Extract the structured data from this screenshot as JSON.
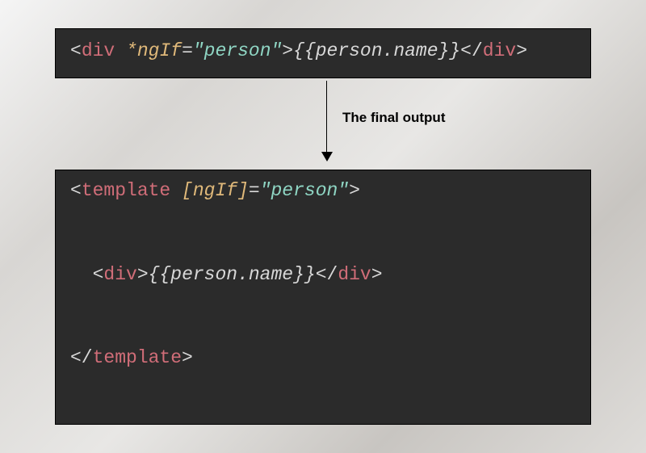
{
  "label": "The final output",
  "top": {
    "tokens": [
      {
        "t": "<",
        "cls": "tok-bracket"
      },
      {
        "t": "div",
        "cls": "tok-tag"
      },
      {
        "t": " ",
        "cls": "tok-plain"
      },
      {
        "t": "*ngIf",
        "cls": "tok-attr"
      },
      {
        "t": "=",
        "cls": "tok-bracket"
      },
      {
        "t": "\"person\"",
        "cls": "tok-string"
      },
      {
        "t": ">",
        "cls": "tok-bracket"
      },
      {
        "t": "{{person.name}}",
        "cls": "tok-expr"
      },
      {
        "t": "</",
        "cls": "tok-bracket"
      },
      {
        "t": "div",
        "cls": "tok-tag"
      },
      {
        "t": ">",
        "cls": "tok-bracket"
      }
    ]
  },
  "bottom": {
    "lines": [
      [
        {
          "t": "<",
          "cls": "tok-bracket"
        },
        {
          "t": "template",
          "cls": "tok-tag"
        },
        {
          "t": " ",
          "cls": "tok-plain"
        },
        {
          "t": "[ngIf]",
          "cls": "tok-attr"
        },
        {
          "t": "=",
          "cls": "tok-bracket"
        },
        {
          "t": "\"person\"",
          "cls": "tok-string"
        },
        {
          "t": ">",
          "cls": "tok-bracket"
        }
      ],
      [],
      [],
      [
        {
          "t": "  ",
          "cls": "tok-plain"
        },
        {
          "t": "<",
          "cls": "tok-bracket"
        },
        {
          "t": "div",
          "cls": "tok-tag"
        },
        {
          "t": ">",
          "cls": "tok-bracket"
        },
        {
          "t": "{{person.name}}",
          "cls": "tok-expr"
        },
        {
          "t": "</",
          "cls": "tok-bracket"
        },
        {
          "t": "div",
          "cls": "tok-tag"
        },
        {
          "t": ">",
          "cls": "tok-bracket"
        }
      ],
      [],
      [],
      [
        {
          "t": "</",
          "cls": "tok-bracket"
        },
        {
          "t": "template",
          "cls": "tok-tag"
        },
        {
          "t": ">",
          "cls": "tok-bracket"
        }
      ]
    ]
  }
}
